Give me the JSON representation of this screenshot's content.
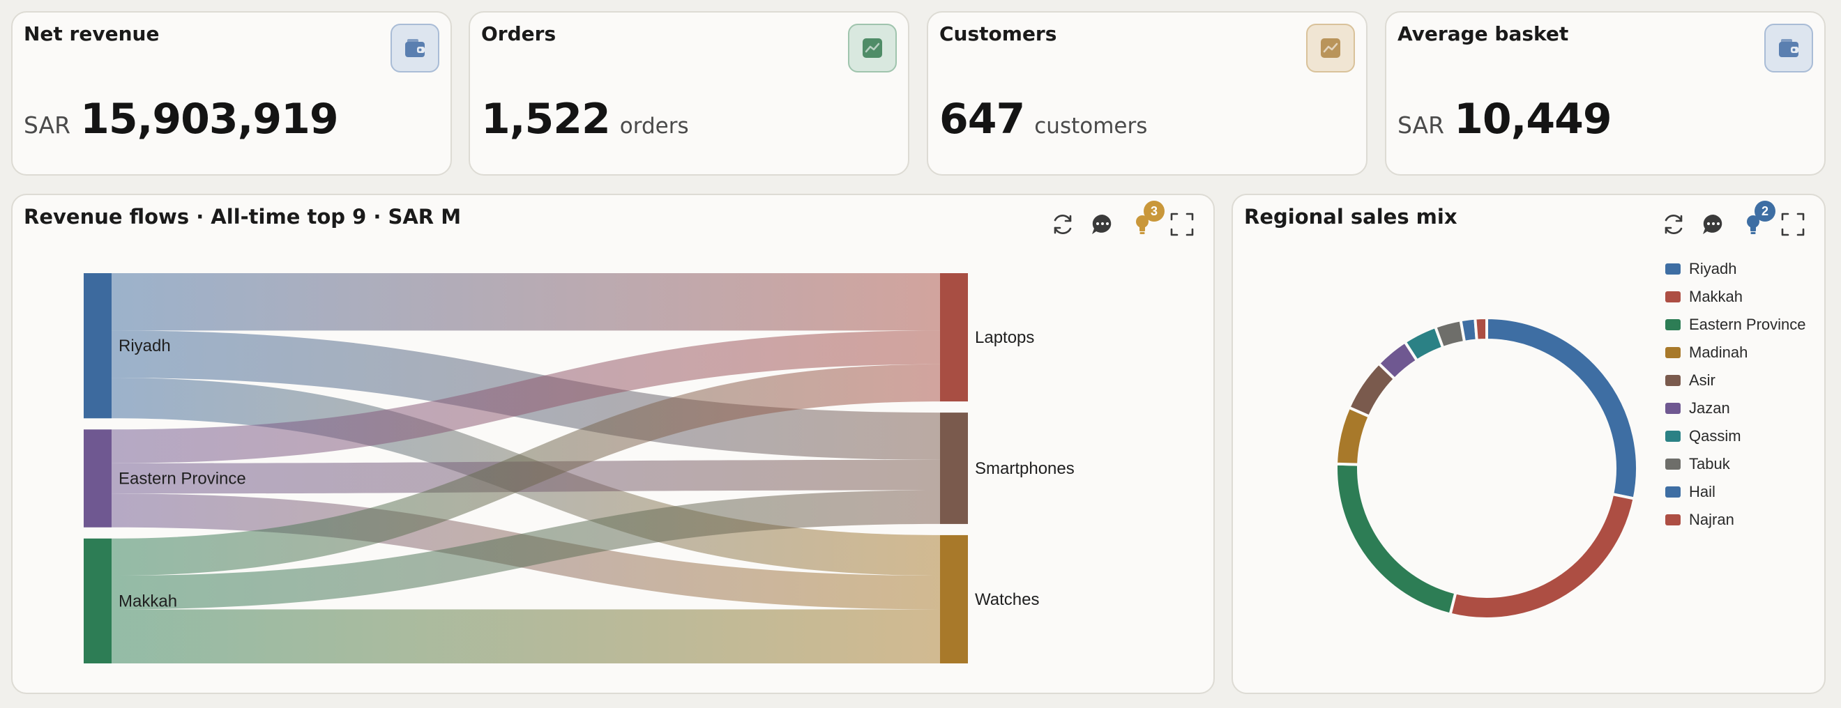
{
  "kpis": [
    {
      "title": "Net revenue",
      "prefix": "SAR",
      "value": "15,903,919",
      "suffix": "",
      "icon": "wallet-icon",
      "icon_bg": "#dde5ef",
      "icon_border": "#a9bcd6",
      "icon_color": "#5a7fb0"
    },
    {
      "title": "Orders",
      "prefix": "",
      "value": "1,522",
      "suffix": "orders",
      "icon": "trend-icon",
      "icon_bg": "#d9e8df",
      "icon_border": "#9fc4ad",
      "icon_color": "#4f8c67"
    },
    {
      "title": "Customers",
      "prefix": "",
      "value": "647",
      "suffix": "customers",
      "icon": "trend-icon",
      "icon_bg": "#f0e5d3",
      "icon_border": "#d9c29a",
      "icon_color": "#b9945a"
    },
    {
      "title": "Average basket",
      "prefix": "SAR",
      "value": "10,449",
      "suffix": "",
      "icon": "wallet-icon",
      "icon_bg": "#dde5ef",
      "icon_border": "#a9bcd6",
      "icon_color": "#5a7fb0"
    }
  ],
  "sankey_panel": {
    "title": "Revenue flows · All-time top 9 · SAR M",
    "insight_count": "3",
    "badge_color": "#c9973a",
    "tools": [
      "refresh-icon",
      "comment-icon",
      "lightbulb-icon",
      "expand-icon"
    ]
  },
  "donut_panel": {
    "title": "Regional sales mix",
    "insight_count": "2",
    "badge_color": "#3e6ea3",
    "tools": [
      "refresh-icon",
      "comment-icon",
      "lightbulb-icon",
      "expand-icon"
    ]
  },
  "chart_data": [
    {
      "type": "sankey",
      "title": "Revenue flows · All-time top 9 · SAR M",
      "sources": [
        {
          "name": "Riyadh",
          "color": "#3d6a9e"
        },
        {
          "name": "Eastern Province",
          "color": "#6f5891"
        },
        {
          "name": "Makkah",
          "color": "#2d7d55"
        }
      ],
      "targets": [
        {
          "name": "Laptops",
          "color": "#a84e43"
        },
        {
          "name": "Smartphones",
          "color": "#7a5a4d"
        },
        {
          "name": "Watches",
          "color": "#a8792a"
        }
      ],
      "links": [
        {
          "source": "Riyadh",
          "target": "Laptops",
          "value": 1.7
        },
        {
          "source": "Riyadh",
          "target": "Smartphones",
          "value": 1.4
        },
        {
          "source": "Riyadh",
          "target": "Watches",
          "value": 1.2
        },
        {
          "source": "Eastern Province",
          "target": "Laptops",
          "value": 1.0
        },
        {
          "source": "Eastern Province",
          "target": "Smartphones",
          "value": 0.9
        },
        {
          "source": "Eastern Province",
          "target": "Watches",
          "value": 1.0
        },
        {
          "source": "Makkah",
          "target": "Laptops",
          "value": 1.1
        },
        {
          "source": "Makkah",
          "target": "Smartphones",
          "value": 1.0
        },
        {
          "source": "Makkah",
          "target": "Watches",
          "value": 1.6
        }
      ]
    },
    {
      "type": "pie",
      "title": "Regional sales mix",
      "donut": true,
      "legend_position": "right",
      "slices": [
        {
          "name": "Riyadh",
          "value": 27.5,
          "color": "#3e6ea3"
        },
        {
          "name": "Makkah",
          "value": 25,
          "color": "#ad4e43"
        },
        {
          "name": "Eastern Province",
          "value": 21,
          "color": "#2d7d55"
        },
        {
          "name": "Madinah",
          "value": 6,
          "color": "#a8792a"
        },
        {
          "name": "Asir",
          "value": 5.5,
          "color": "#7a5a4d"
        },
        {
          "name": "Jazan",
          "value": 3.5,
          "color": "#6f5891"
        },
        {
          "name": "Qassim",
          "value": 3.5,
          "color": "#2b8185"
        },
        {
          "name": "Tabuk",
          "value": 2.7,
          "color": "#6e6e6a"
        },
        {
          "name": "Hail",
          "value": 1.5,
          "color": "#3e6ea3"
        },
        {
          "name": "Najran",
          "value": 1.2,
          "color": "#ad4e43"
        }
      ]
    }
  ]
}
